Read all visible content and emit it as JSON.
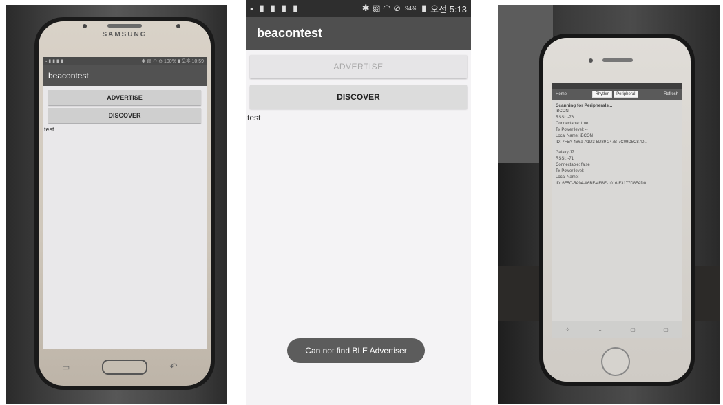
{
  "samsung": {
    "brand": "SAMSUNG",
    "status_left": "▪ ▮ ▮ ▮ ▮",
    "status_right": "✱ ▧ ◠ ⊘ 100% ▮ 오후 10:59",
    "app_title": "beacontest",
    "advertise_label": "ADVERTISE",
    "discover_label": "DISCOVER",
    "text": "test",
    "nav_recent": "▭",
    "nav_back": "↶"
  },
  "screenshot": {
    "status_icons_left": [
      "▪",
      "▮",
      "▮",
      "▮",
      "▮"
    ],
    "status_right": "✱ ▧ ◠ ⊘",
    "battery": "94%",
    "time": "오전 5:13",
    "app_title": "beacontest",
    "advertise_label": "ADVERTISE",
    "discover_label": "DISCOVER",
    "text": "test",
    "toast": "Can not find BLE Advertiser"
  },
  "iphone": {
    "nav_left": "Home",
    "seg_1": "Rhythm",
    "seg_2": "Peripheral",
    "nav_right": "Refresh",
    "heading": "Scanning for Peripherals...",
    "p1": [
      "iBCON",
      "RSSI: -76",
      "Connectable: true",
      "Tx Power level: --",
      "Local Name: iBCON",
      "ID: 7F5A-4B6a-A1D3-5D89-247B-7C09D5C87D..."
    ],
    "p2": [
      "Galaxy J7",
      "RSSI: -71",
      "Connectable: false",
      "Tx Power level: --",
      "Local Name: --",
      "ID: 6F5C-5A94-A6BF-4FBE-1016-F3177D8FAD0"
    ],
    "tab_icons": [
      "✧",
      "⌄",
      "▢",
      "▢"
    ]
  }
}
